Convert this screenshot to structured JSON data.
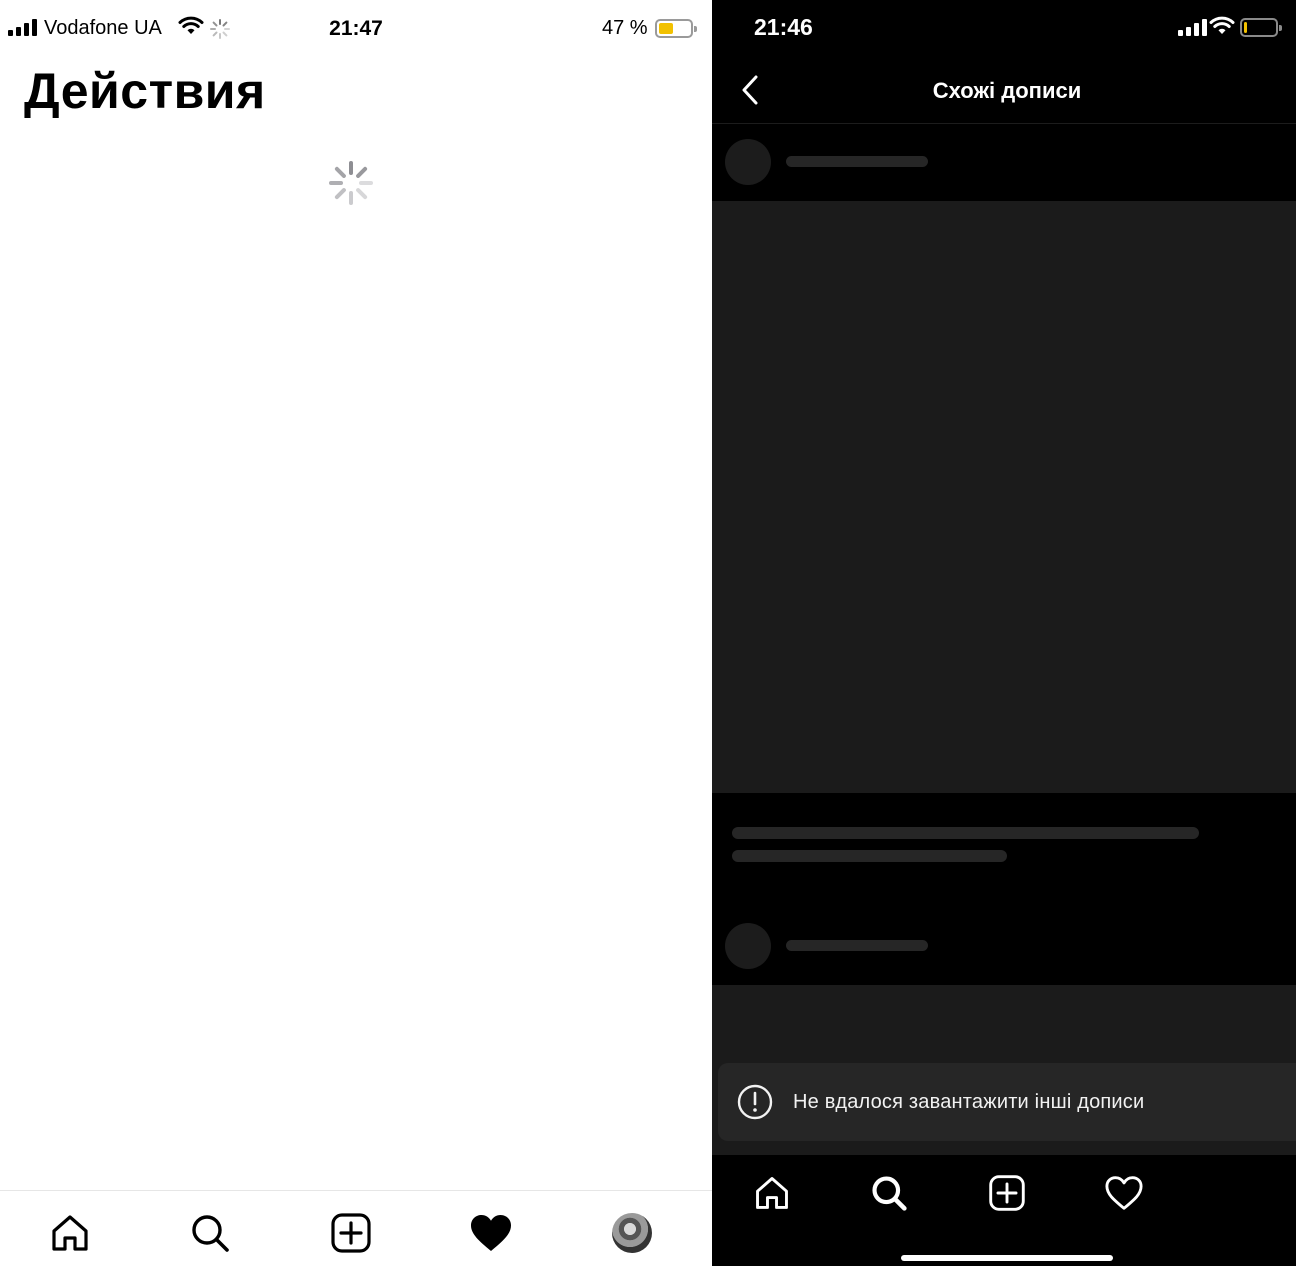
{
  "left_screen": {
    "status_bar": {
      "carrier": "Vodafone UA",
      "time": "21:47",
      "battery_percent_text": "47 %",
      "battery_level": 0.47
    },
    "page_title": "Действия",
    "tab_bar": {
      "items": [
        "home-icon",
        "search-icon",
        "new-post-icon",
        "heart-filled-icon",
        "profile-avatar"
      ],
      "active": "heart-filled-icon"
    },
    "colors": {
      "background": "#ffffff",
      "text": "#000000",
      "battery_fill": "#f2c100"
    }
  },
  "right_screen": {
    "status_bar": {
      "time": "21:46",
      "battery_level": 0.1
    },
    "header": {
      "title": "Схожі дописи",
      "back_icon": "chevron-left-icon"
    },
    "toast": {
      "message": "Не вдалося завантажити інші дописи",
      "icon": "alert-circle-icon"
    },
    "tab_bar": {
      "items": [
        "home-icon",
        "search-icon",
        "new-post-icon",
        "heart-outline-icon"
      ],
      "active": "search-icon"
    },
    "colors": {
      "background": "#000000",
      "text": "#ffffff",
      "skeleton": "#1b1b1b",
      "toast_background": "#262626"
    }
  }
}
